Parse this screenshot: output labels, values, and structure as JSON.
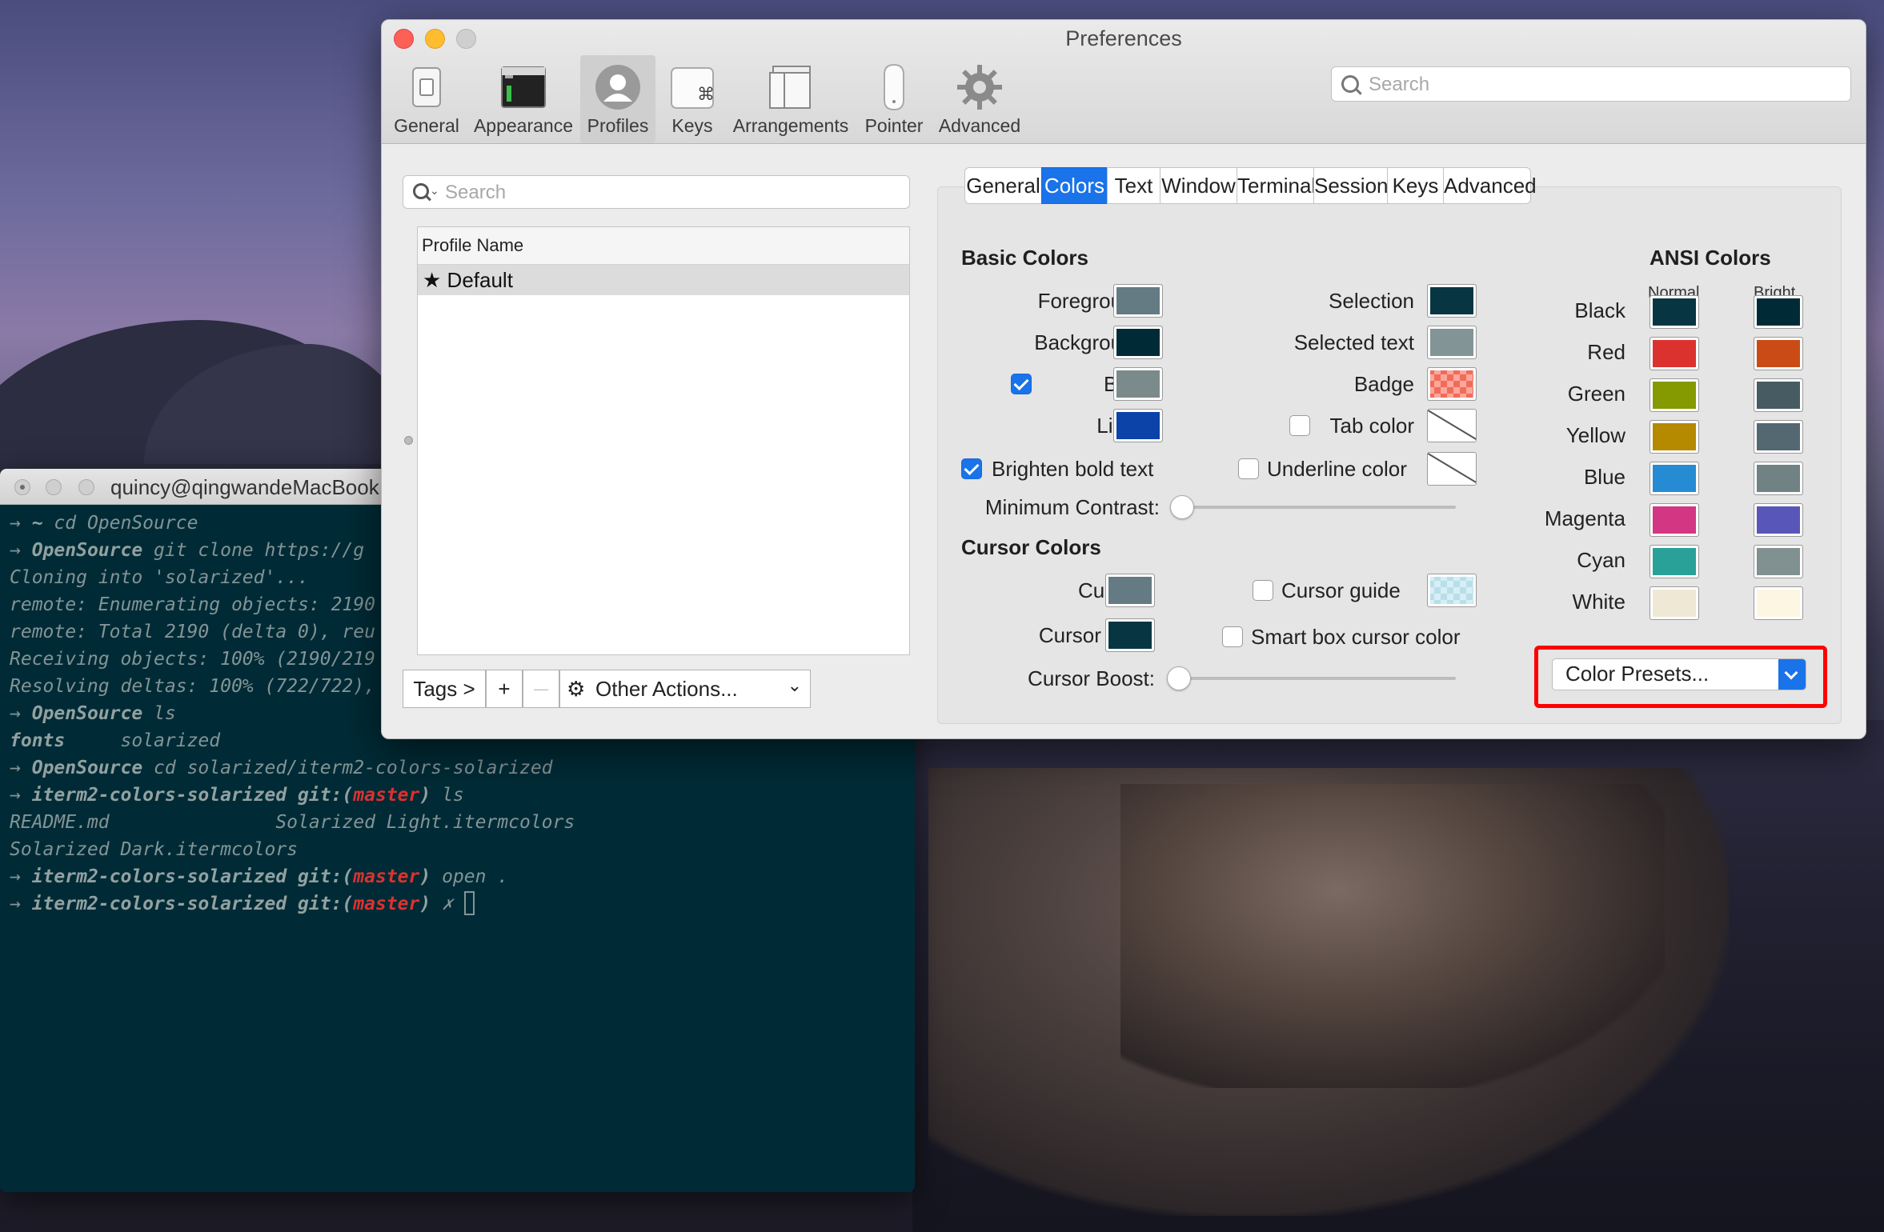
{
  "terminal": {
    "title": "quincy@qingwandeMacBook",
    "lines": [
      [
        "→ ",
        "~",
        " cd OpenSource"
      ],
      [
        "→ ",
        "OpenSource",
        " git clone https://g"
      ],
      [
        "",
        "",
        "Cloning into 'solarized'..."
      ],
      [
        "",
        "",
        "remote: Enumerating objects: 2190"
      ],
      [
        "",
        "",
        "remote: Total 2190 (delta 0), reu"
      ],
      [
        "",
        "",
        "Receiving objects: 100% (2190/219"
      ],
      [
        "",
        "",
        "Resolving deltas: 100% (722/722),"
      ],
      [
        "→ ",
        "OpenSource",
        " ls"
      ],
      [
        "",
        "fonts",
        "     solarized"
      ],
      [
        "→ ",
        "OpenSource",
        " cd solarized/iterm2-colors-solarized"
      ],
      [
        "→ ",
        "iterm2-colors-solarized git:(master)",
        " ls"
      ],
      [
        "",
        "",
        "README.md               Solarized Light.itermcolors"
      ],
      [
        "",
        "",
        "Solarized Dark.itermcolors"
      ],
      [
        "→ ",
        "iterm2-colors-solarized git:(master)",
        " open ."
      ],
      [
        "→ ",
        "iterm2-colors-solarized git:(master)",
        " ✗ "
      ]
    ]
  },
  "prefs": {
    "title": "Preferences",
    "toolbar": [
      {
        "label": "General",
        "icon": "switch-icon"
      },
      {
        "label": "Appearance",
        "icon": "appearance-icon"
      },
      {
        "label": "Profiles",
        "icon": "profile-icon",
        "selected": true
      },
      {
        "label": "Keys",
        "icon": "command-key-icon"
      },
      {
        "label": "Arrangements",
        "icon": "arrangements-icon"
      },
      {
        "label": "Pointer",
        "icon": "mouse-icon"
      },
      {
        "label": "Advanced",
        "icon": "gear-icon"
      }
    ],
    "search_placeholder": "Search",
    "profiles_search_placeholder": "Search",
    "profile_list_header": "Profile Name",
    "profiles": [
      {
        "name": "Default",
        "icon": "star-icon"
      }
    ],
    "bottom": {
      "tags": "Tags >",
      "add": "+",
      "remove": "—",
      "other_actions": "Other Actions..."
    },
    "tabs": [
      "General",
      "Colors",
      "Text",
      "Window",
      "Terminal",
      "Session",
      "Keys",
      "Advanced"
    ],
    "active_tab": "Colors",
    "basic_colors": {
      "heading": "Basic Colors",
      "foreground": {
        "label": "Foreground",
        "color": "#657b83"
      },
      "background": {
        "label": "Background",
        "color": "#002b36"
      },
      "bold": {
        "label": "Bold",
        "color": "#7b8a8b",
        "checked": true
      },
      "links": {
        "label": "Links",
        "color": "#0b43a8"
      },
      "selection": {
        "label": "Selection",
        "color": "#073642"
      },
      "selected_text": {
        "label": "Selected text",
        "color": "#839496"
      },
      "badge": {
        "label": "Badge",
        "color": "#f26b5b"
      },
      "tab_color": {
        "label": "Tab color",
        "checked": false
      },
      "underline_color": {
        "label": "Underline color",
        "checked": false
      },
      "brighten_bold": {
        "label": "Brighten bold text",
        "checked": true
      },
      "min_contrast": {
        "label": "Minimum Contrast:",
        "value": 0
      }
    },
    "cursor_colors": {
      "heading": "Cursor Colors",
      "cursor": {
        "label": "Cursor",
        "color": "#657b83"
      },
      "cursor_text": {
        "label": "Cursor text",
        "color": "#073642"
      },
      "cursor_guide": {
        "label": "Cursor guide",
        "checked": false
      },
      "smart_box": {
        "label": "Smart box cursor color",
        "checked": false
      },
      "cursor_boost": {
        "label": "Cursor Boost:",
        "value": 0
      }
    },
    "ansi": {
      "heading": "ANSI Colors",
      "normal_label": "Normal",
      "bright_label": "Bright",
      "rows": [
        {
          "name": "Black",
          "normal": "#073642",
          "bright": "#002b36"
        },
        {
          "name": "Red",
          "normal": "#dc322f",
          "bright": "#cb4b16"
        },
        {
          "name": "Green",
          "normal": "#859900",
          "bright": "#475b62"
        },
        {
          "name": "Yellow",
          "normal": "#b58900",
          "bright": "#536870"
        },
        {
          "name": "Blue",
          "normal": "#268bd2",
          "bright": "#708284"
        },
        {
          "name": "Magenta",
          "normal": "#d33682",
          "bright": "#5956ba"
        },
        {
          "name": "Cyan",
          "normal": "#2aa198",
          "bright": "#819090"
        },
        {
          "name": "White",
          "normal": "#eee8d5",
          "bright": "#fdf6e3"
        }
      ]
    },
    "color_presets": "Color Presets..."
  }
}
